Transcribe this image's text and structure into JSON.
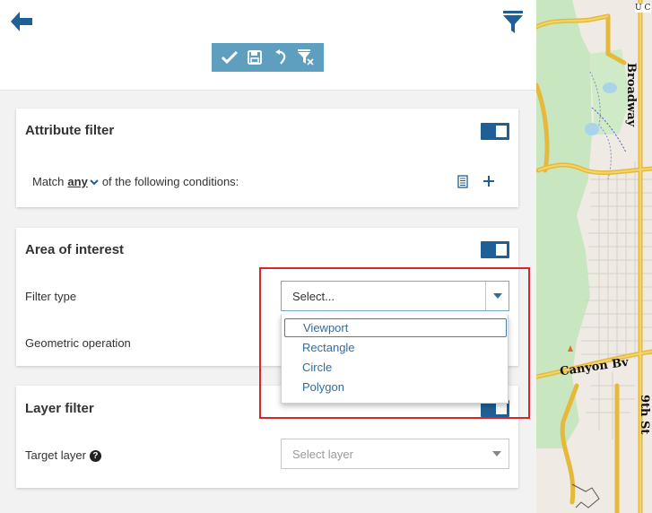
{
  "toolbar": {
    "icons": [
      "check-icon",
      "save-icon",
      "undo-icon",
      "clear-filter-icon"
    ]
  },
  "colors": {
    "accent": "#1f5f95",
    "toolbar_bg": "#5e9fc0",
    "link": "#2e6da4",
    "highlight": "#d8262b"
  },
  "attribute_filter": {
    "title": "Attribute filter",
    "enabled": true,
    "match_prefix": "Match",
    "match_mode": "any",
    "match_suffix": "of the following conditions:"
  },
  "area_of_interest": {
    "title": "Area of interest",
    "enabled": true,
    "filter_type_label": "Filter type",
    "filter_type_value": "Select...",
    "geometric_operation_label": "Geometric operation",
    "options": [
      "Viewport",
      "Rectangle",
      "Circle",
      "Polygon"
    ]
  },
  "layer_filter": {
    "title": "Layer filter",
    "target_layer_label": "Target layer",
    "help_glyph": "?",
    "target_layer_placeholder": "Select layer"
  },
  "map": {
    "labels": {
      "broadway": "Broadway",
      "canyon": "Canyon Bv",
      "ninth": "9th St",
      "top_corner": "U C"
    }
  }
}
